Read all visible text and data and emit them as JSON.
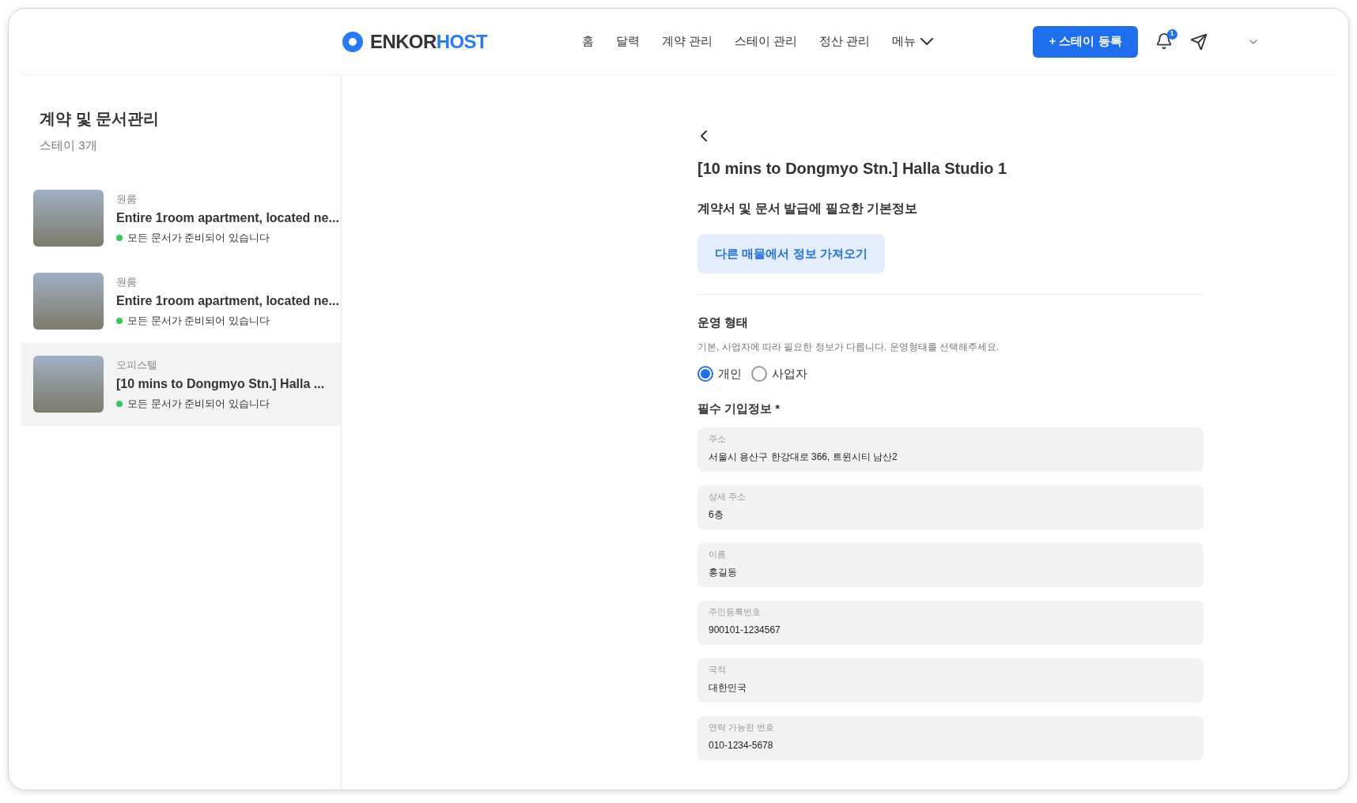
{
  "header": {
    "logo": {
      "part1": "ENKOR",
      "part2": "HOST"
    },
    "nav": [
      {
        "label": "홈",
        "kind": "link"
      },
      {
        "label": "달력",
        "kind": "link"
      },
      {
        "label": "계약 관리",
        "kind": "link"
      },
      {
        "label": "스테이 관리",
        "kind": "link"
      },
      {
        "label": "정산 관리",
        "kind": "link"
      },
      {
        "label": "메뉴",
        "kind": "dropdown"
      }
    ],
    "primary_button": {
      "icon": "+",
      "label": "스테이 등록"
    },
    "notification_badge": "1"
  },
  "sidebar": {
    "title": "계약 및 문서관리",
    "count": "스테이 3개",
    "items": [
      {
        "type": "원룸",
        "title": "Entire 1room apartment, located ne...",
        "status": "모든 문서가 준비되어 있습니다",
        "color": "#34c759",
        "selected": false
      },
      {
        "type": "원룸",
        "title": "Entire 1room apartment, located ne...",
        "status": "모든 문서가 준비되어 있습니다",
        "color": "#34c759",
        "selected": false
      },
      {
        "type": "오피스텔",
        "title": "[10 mins to Dongmyo Stn.] Halla ...",
        "status": "모든 문서가 준비되어 있습니다",
        "color": "#34c759",
        "selected": true
      }
    ]
  },
  "detail": {
    "title": "[10 mins to Dongmyo Stn.] Halla Studio 1",
    "section_title": "계약서 및 문서 발급에 필요한 기본정보",
    "import_button": "다른 매물에서 정보 가져오기",
    "operation": {
      "title": "운영 형태",
      "description": "기본, 사업자에 따라 필요한 정보가 다릅니다. 운영형태를 선택해주세요.",
      "options": [
        {
          "label": "개인",
          "selected": true
        },
        {
          "label": "사업자",
          "selected": false
        }
      ]
    },
    "required_title": "필수 기입정보 *",
    "fields": [
      {
        "label": "주소",
        "value": "서울시 용산구 한강대로 366, 트윈시티 남산2"
      },
      {
        "label": "상세 주소",
        "value": "6층"
      },
      {
        "label": "이름",
        "value": "홍길동"
      },
      {
        "label": "주민등록번호",
        "value": "900101-1234567"
      },
      {
        "label": "국적",
        "value": "대한민국"
      },
      {
        "label": "연락 가능한 번호",
        "value": "010-1234-5678"
      }
    ]
  }
}
